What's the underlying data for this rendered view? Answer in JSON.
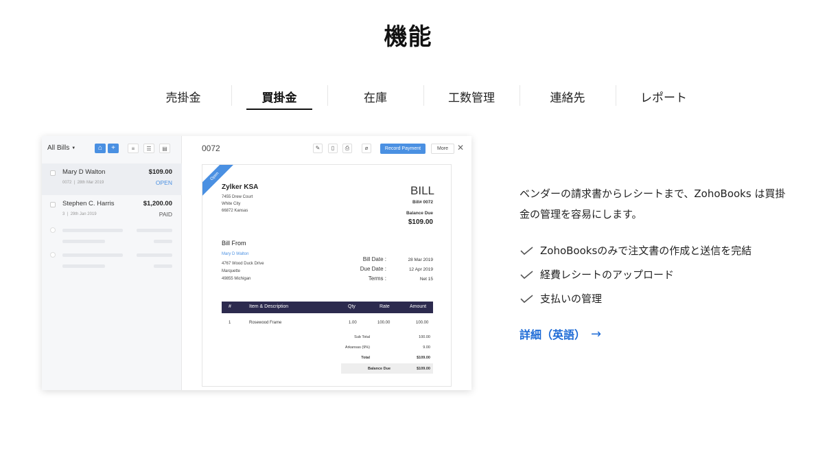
{
  "title": "機能",
  "tabs": [
    {
      "label": "売掛金",
      "active": false
    },
    {
      "label": "買掛金",
      "active": true
    },
    {
      "label": "在庫",
      "active": false
    },
    {
      "label": "工数管理",
      "active": false
    },
    {
      "label": "連絡先",
      "active": false
    },
    {
      "label": "レポート",
      "active": false
    }
  ],
  "mock": {
    "list_title": "All Bills",
    "bills": [
      {
        "name": "Mary D Walton",
        "amount": "$109.00",
        "ref": "0072",
        "date": "28th Mar 2019",
        "status": "OPEN"
      },
      {
        "name": "Stephen C. Harris",
        "amount": "$1,200.00",
        "ref": "3",
        "date": "29th Jan 2019",
        "status": "PAID"
      }
    ],
    "bill_id": "0072",
    "record_payment": "Record Payment",
    "more": "More",
    "ribbon": "Open",
    "company": "Zylker KSA",
    "company_address": [
      "7455 Drew Court",
      "White City",
      "66872 Kansas"
    ],
    "bill_heading": "BILL",
    "bill_number": "Bill# 0072",
    "balance_due_label": "Balance Due",
    "balance_due_amount": "$109.00",
    "bill_from_label": "Bill From",
    "vendor_name": "Mary D Walton",
    "vendor_address": [
      "4767 Wood Duck Drive",
      "Marquette",
      "49855 Michigan"
    ],
    "bill_date_label": "Bill Date :",
    "bill_date": "28 Mar 2019",
    "due_date_label": "Due Date :",
    "due_date": "12 Apr 2019",
    "terms_label": "Terms :",
    "terms": "Net 15",
    "columns": {
      "num": "#",
      "item": "Item & Description",
      "qty": "Qty",
      "rate": "Rate",
      "amount": "Amount"
    },
    "line": {
      "num": "1",
      "item": "Rosewood Frame",
      "qty": "1.00",
      "rate": "100.00",
      "amount": "100.00"
    },
    "totals": {
      "sub_total_label": "Sub Total",
      "sub_total": "100.00",
      "tax_label": "Arkansas (9%)",
      "tax": "9.00",
      "total_label": "Total",
      "total": "$109.00",
      "balance_label": "Balance Due",
      "balance": "$109.00"
    }
  },
  "intro": "ベンダーの請求書からレシートまで、ZohoBooks は買掛金の管理を容易にします。",
  "features": [
    "ZohoBooksのみで注文書の作成と送信を完結",
    "経費レシートのアップロード",
    "支払いの管理"
  ],
  "more_link": "詳細（英語）",
  "colors": {
    "accent": "#1e6bd6",
    "app_blue": "#4a90e2",
    "table_header": "#2c2a4e"
  }
}
